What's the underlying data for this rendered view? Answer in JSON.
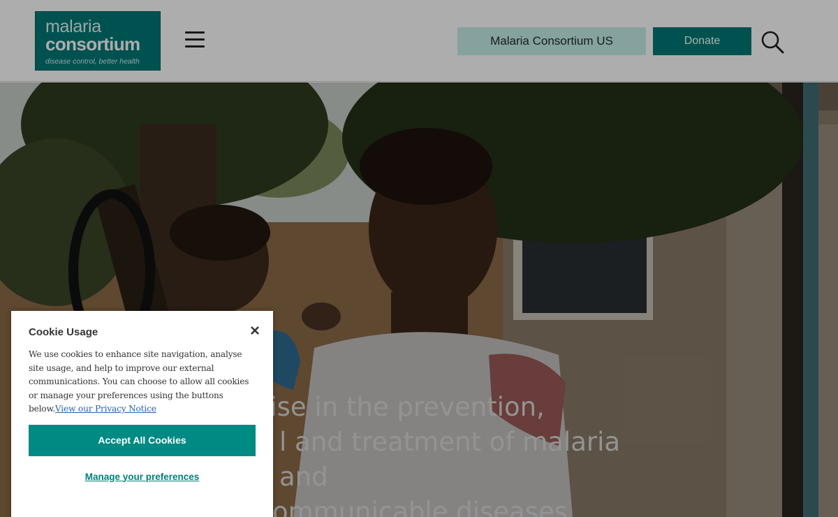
{
  "header": {
    "logo": {
      "line1": "malaria",
      "line2": "consortium",
      "tagline": "disease control, better health"
    },
    "us_button": "Malaria Consortium US",
    "donate_button": "Donate",
    "icons": {
      "menu": "hamburger-menu-icon",
      "search": "search-icon"
    }
  },
  "hero": {
    "lines": [
      "ecialise in the prevention,",
      "l and treatment of malaria and",
      "ommunicable diseases"
    ]
  },
  "cookie": {
    "title": "Cookie Usage",
    "body": "We use cookies to enhance site navigation, analyse site usage, and help to improve our external communications. You can choose to allow all cookies or manage your preferences using the buttons below.",
    "privacy_link": "View our Privacy Notice",
    "accept_button": "Accept All Cookies",
    "manage_link": "Manage your preferences"
  },
  "colors": {
    "brand_teal": "#007a78",
    "us_button_bg": "#c6efe9",
    "link_blue": "#2563a6"
  }
}
